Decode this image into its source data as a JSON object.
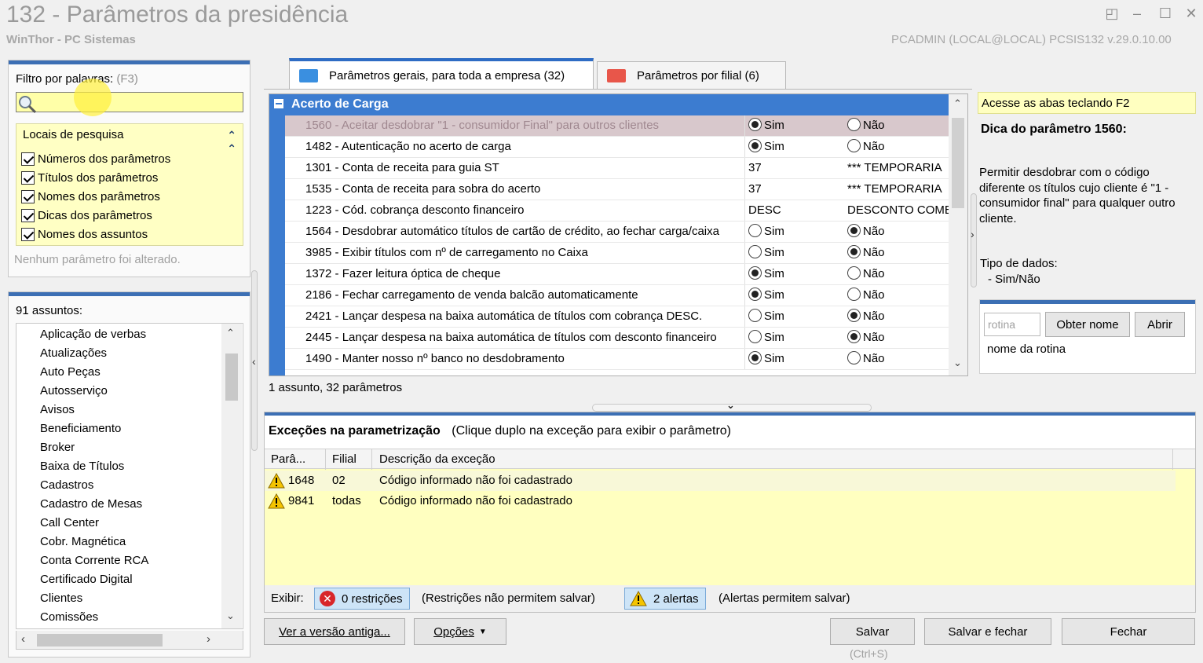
{
  "window": {
    "title": "132 - Parâmetros da presidência",
    "subtitle": "WinThor - PC Sistemas",
    "user_info": "PCADMIN (LOCAL@LOCAL)   PCSIS132  v.29.0.10.00"
  },
  "filter": {
    "label": "Filtro por palavras:",
    "shortcut": "(F3)",
    "value": "",
    "locations_title": "Locais de pesquisa",
    "locations": [
      {
        "label": "Números dos parâmetros",
        "checked": true
      },
      {
        "label": "Títulos dos parâmetros",
        "checked": true
      },
      {
        "label": "Nomes dos parâmetros",
        "checked": true
      },
      {
        "label": "Dicas dos parâmetros",
        "checked": true
      },
      {
        "label": "Nomes dos assuntos",
        "checked": true
      }
    ],
    "status": "Nenhum parâmetro foi alterado."
  },
  "subjects": {
    "count_label": "91 assuntos:",
    "items": [
      "Aplicação de verbas",
      "Atualizações",
      "Auto Peças",
      "Autosserviço",
      "Avisos",
      "Beneficiamento",
      "Broker",
      "Baixa de Títulos",
      "Cadastros",
      "Cadastro de Mesas",
      "Call Center",
      "Cobr. Magnética",
      "Conta Corrente RCA",
      "Certificado Digital",
      "Clientes",
      "Comissões"
    ]
  },
  "tabs": [
    {
      "label": "Parâmetros gerais, para toda a empresa  (32)",
      "active": true,
      "icon": "folder-blue-icon"
    },
    {
      "label": "Parâmetros por filial  (6)",
      "active": false,
      "icon": "folder-red-icon"
    }
  ],
  "grid": {
    "group_title": "Acerto de Carga",
    "rows": [
      {
        "name": "1560 - Aceitar desdobrar \"1 - consumidor Final\" para outros clientes",
        "type": "bool",
        "value": "sim",
        "sim": "Sim",
        "nao": "Não",
        "selected": true
      },
      {
        "name": "1482 - Autenticação no acerto de carga",
        "type": "bool",
        "value": "sim",
        "sim": "Sim",
        "nao": "Não"
      },
      {
        "name": "1301 - Conta de receita para guia ST",
        "type": "lookup",
        "code": "37",
        "desc": "*** TEMPORARIA"
      },
      {
        "name": "1535 - Conta de receita para sobra do acerto",
        "type": "lookup",
        "code": "37",
        "desc": "*** TEMPORARIA"
      },
      {
        "name": "1223 - Cód. cobrança desconto financeiro",
        "type": "lookup",
        "code": "DESC",
        "desc": "DESCONTO COMERCIAL"
      },
      {
        "name": "1564 - Desdobrar automático títulos de cartão de crédito, ao fechar carga/caixa",
        "type": "bool",
        "value": "nao",
        "sim": "Sim",
        "nao": "Não"
      },
      {
        "name": "3985 - Exibir títulos com nº de carregamento no Caixa",
        "type": "bool",
        "value": "nao",
        "sim": "Sim",
        "nao": "Não"
      },
      {
        "name": "1372 - Fazer leitura óptica de cheque",
        "type": "bool",
        "value": "sim",
        "sim": "Sim",
        "nao": "Não"
      },
      {
        "name": "2186 - Fechar carregamento de venda balcão automaticamente",
        "type": "bool",
        "value": "sim",
        "sim": "Sim",
        "nao": "Não"
      },
      {
        "name": "2421 - Lançar despesa na baixa automática de títulos com cobrança DESC.",
        "type": "bool",
        "value": "nao",
        "sim": "Sim",
        "nao": "Não"
      },
      {
        "name": "2445 - Lançar despesa na baixa automática de títulos com desconto financeiro",
        "type": "bool",
        "value": "nao",
        "sim": "Sim",
        "nao": "Não"
      },
      {
        "name": "1490 - Manter nosso nº banco no desdobramento",
        "type": "bool",
        "value": "sim",
        "sim": "Sim",
        "nao": "Não"
      }
    ],
    "status": "1 assunto, 32 parâmetros"
  },
  "hint": {
    "shortcut_tip": "Acesse as abas teclando F2",
    "title": "Dica do parâmetro 1560:",
    "body": "Permitir desdobrar com o código diferente os títulos cujo cliente é \"1 - consumidor final\" para qualquer outro cliente.",
    "type_label": "Tipo de dados:",
    "type_value": "- Sim/Não",
    "routine_placeholder": "rotina",
    "get_name_button": "Obter nome",
    "open_button": "Abrir",
    "routine_label": "nome da rotina"
  },
  "exceptions": {
    "title": "Exceções na parametrização",
    "subtitle": "(Clique duplo na exceção para exibir o parâmetro)",
    "columns": [
      "Parâ...",
      "Filial",
      "Descrição da exceção"
    ],
    "rows": [
      {
        "param": "1648",
        "branch": "02",
        "description": "Código informado não foi cadastrado"
      },
      {
        "param": "9841",
        "branch": "todas",
        "description": "Código informado não foi cadastrado"
      }
    ],
    "show_label": "Exibir:",
    "restrictions_button": "0 restrições",
    "restrictions_note": "(Restrições não permitem salvar)",
    "alerts_button": "2 alertas",
    "alerts_note": "(Alertas permitem salvar)"
  },
  "footer": {
    "old_version_button": "Ver a versão antiga...",
    "options_button": "Opções",
    "save_button": "Salvar",
    "save_shortcut": "(Ctrl+S)",
    "save_close_button": "Salvar e fechar",
    "close_button": "Fechar"
  },
  "colors": {
    "accent_blue": "#3c7cd0",
    "filter_yellow": "#ffffa8",
    "hint_yellow": "#ffffc0",
    "error_red": "#d8262a"
  }
}
